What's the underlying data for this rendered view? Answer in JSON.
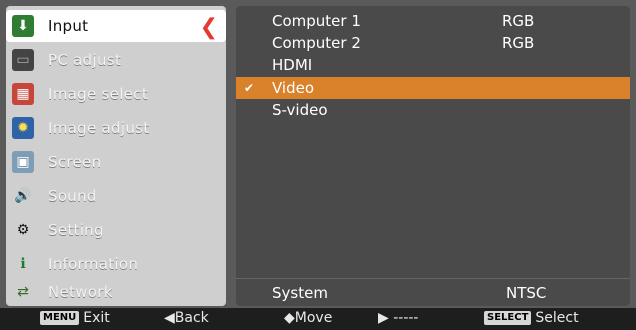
{
  "menu": {
    "items": [
      {
        "label": "Input",
        "icon": "input-icon",
        "selected": true
      },
      {
        "label": "PC adjust",
        "icon": "pc-adjust-icon"
      },
      {
        "label": "Image select",
        "icon": "image-select-icon"
      },
      {
        "label": "Image adjust",
        "icon": "image-adjust-icon"
      },
      {
        "label": "Screen",
        "icon": "screen-icon"
      },
      {
        "label": "Sound",
        "icon": "sound-icon"
      },
      {
        "label": "Setting",
        "icon": "setting-icon"
      },
      {
        "label": "Information",
        "icon": "information-icon"
      },
      {
        "label": "Network",
        "icon": "network-icon"
      }
    ]
  },
  "input_list": {
    "rows": [
      {
        "name": "Computer 1",
        "value": "RGB"
      },
      {
        "name": "Computer 2",
        "value": "RGB"
      },
      {
        "name": "HDMI",
        "value": ""
      },
      {
        "name": "Video",
        "value": "",
        "highlight": true,
        "checked": true
      },
      {
        "name": "S-video",
        "value": ""
      }
    ],
    "system": {
      "label": "System",
      "value": "NTSC"
    }
  },
  "footer": {
    "exit_tag": "MENU",
    "exit_label": "Exit",
    "back_label": "◀Back",
    "move_label": "◆Move",
    "right_label": "▶ -----",
    "select_tag": "SELECT",
    "select_label": "Select"
  },
  "colors": {
    "highlight": "#d9822b",
    "arrow": "#e33b2f"
  }
}
